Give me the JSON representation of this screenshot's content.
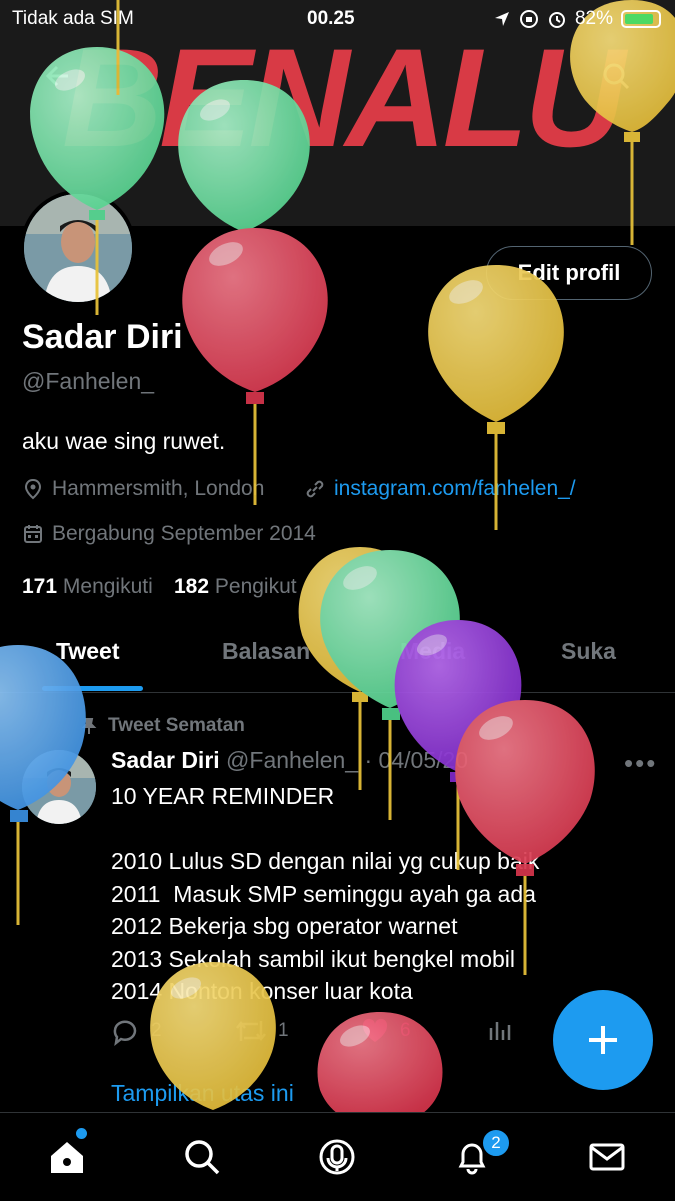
{
  "status_bar": {
    "carrier": "Tidak ada SIM",
    "time": "00.25",
    "battery": "82%"
  },
  "banner": {
    "text": "BENALU"
  },
  "profile": {
    "edit_button": "Edit profil",
    "name": "Sadar Diri",
    "handle": "@Fanhelen_",
    "bio": "aku wae sing ruwet.",
    "location": "Hammersmith, London",
    "website": "instagram.com/fanhelen_/",
    "joined": "Bergabung September 2014",
    "following_count": "171",
    "following_label": "Mengikuti",
    "followers_count": "182",
    "followers_label": "Pengikut"
  },
  "tabs": [
    "Tweet",
    "Balasan",
    "Media",
    "Suka"
  ],
  "tweet": {
    "pinned_label": "Tweet Sematan",
    "name": "Sadar Diri",
    "handle": "@Fanhelen_",
    "date": "· 04/05/20",
    "body": "10 YEAR REMINDER\n\n2010 Lulus SD dengan nilai yg cukup baik\n2011  Masuk SMP seminggu ayah ga ada\n2012 Bekerja sbg operator warnet\n2013 Sekolah sambil ikut bengkel mobil\n2014 Nonton konser luar kota",
    "replies": "2",
    "retweets": "1",
    "likes": "6",
    "show_thread": "Tampilkan utas ini"
  },
  "bottom_nav": {
    "notifications_badge": "2"
  },
  "colors": {
    "accent": "#1d9bf0",
    "banner_text": "#d83a45",
    "like": "#f91880"
  }
}
